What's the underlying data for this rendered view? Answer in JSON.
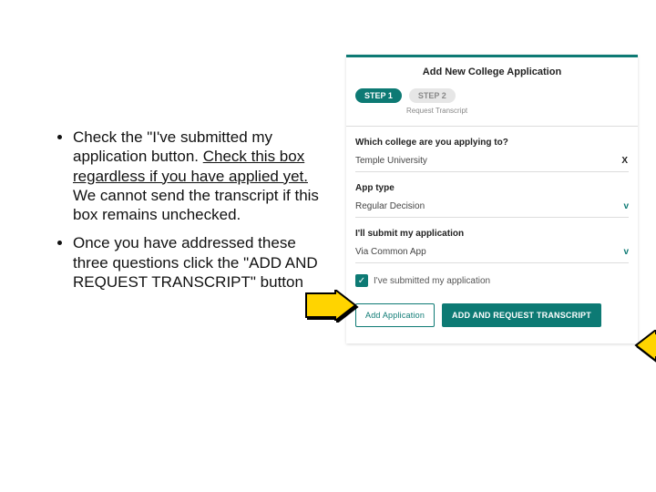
{
  "instructions": {
    "bullet1_pre": "Check the \"I've submitted my application button. ",
    "bullet1_u": "Check this box regardless if you have applied yet. ",
    "bullet1_post": "We cannot send the transcript if this box remains unchecked.",
    "bullet2": "Once you have addressed these three questions click the \"ADD AND REQUEST TRANSCRIPT\" button"
  },
  "panel": {
    "title": "Add New College Application",
    "step1": "STEP 1",
    "step2": "STEP 2",
    "step_caption": "Request Transcript",
    "q_college": "Which college are you applying to?",
    "college_value": "Temple University",
    "q_apptype": "App type",
    "apptype_value": "Regular Decision",
    "q_submit": "I'll submit my application",
    "submit_value": "Via Common App",
    "checkbox_label": "I've submitted my application",
    "btn_add": "Add Application",
    "btn_primary": "ADD AND REQUEST TRANSCRIPT"
  }
}
